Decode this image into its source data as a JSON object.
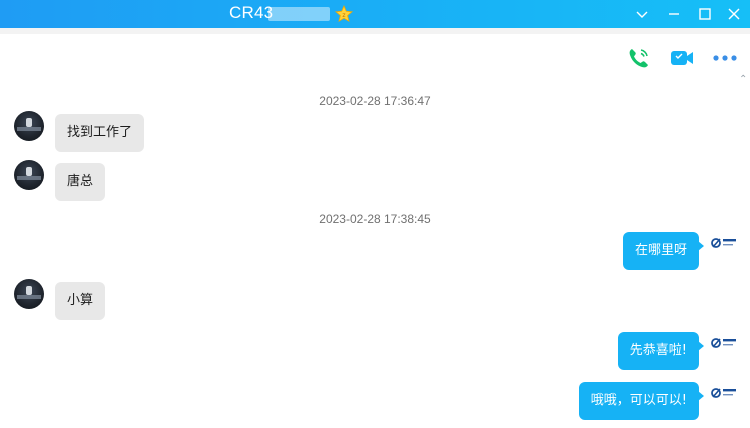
{
  "window": {
    "title": "CR43",
    "min_glyph": "—",
    "colors": {
      "titlebar": "#19b0f6",
      "bubble_out": "#16b2f5",
      "bubble_in": "#e8e8e8"
    }
  },
  "toolbar": {
    "icons": [
      "phone-icon",
      "video-call-icon",
      "more-icon"
    ]
  },
  "messages": [
    {
      "timestamp": "2023-02-28 17:36:47"
    },
    {
      "text": "找到工作了"
    },
    {
      "text": "唐总"
    },
    {
      "timestamp": "2023-02-28 17:38:45"
    },
    {
      "text": "在哪里呀"
    },
    {
      "text": "小算"
    },
    {
      "text": "先恭喜啦!"
    },
    {
      "text": "哦哦，可以可以!"
    }
  ]
}
